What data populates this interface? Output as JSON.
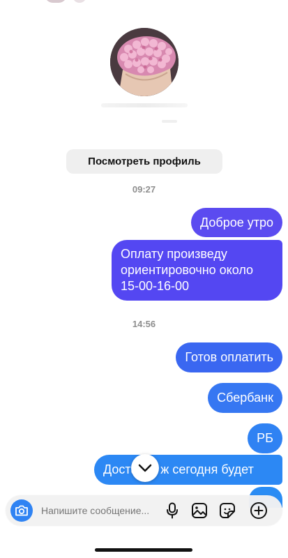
{
  "chat": {
    "view_profile_label": "Посмотреть профиль",
    "timestamps": [
      "09:27",
      "14:56"
    ],
    "messages": [
      {
        "text": "Доброе утро"
      },
      {
        "lines": [
          "Оплату произведу",
          "ориентировочно около",
          "15-00-16-00"
        ]
      },
      {
        "text": "Готов оплатить"
      },
      {
        "text": "Сбербанк"
      },
      {
        "text": "РБ"
      },
      {
        "text": "Доставка ж сегодня будет"
      }
    ]
  },
  "composer": {
    "placeholder": "Напишите сообщение..."
  },
  "icons": {
    "scroll": "chevron-down-icon",
    "camera": "camera-icon",
    "mic": "microphone-icon",
    "gallery": "gallery-icon",
    "sticker": "sticker-icon",
    "plus": "plus-circle-icon"
  },
  "colors": {
    "accent_blue": "#2f83f3",
    "bubble_purple": "#5b4bf0",
    "timestamp_gray": "#8e8e8e"
  }
}
